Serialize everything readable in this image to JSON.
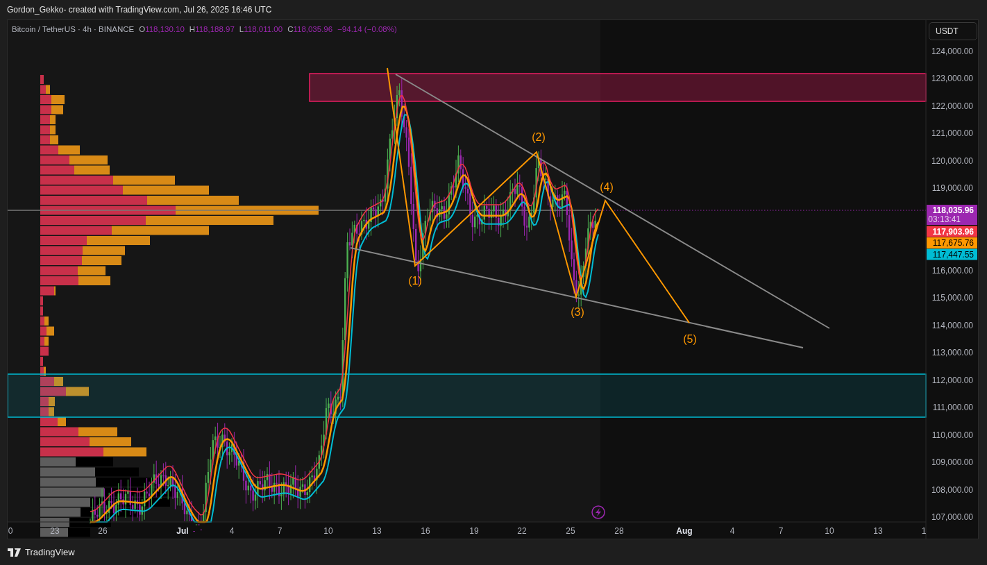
{
  "header": {
    "title": "Gordon_Gekko- created with TradingView.com, Jul 26, 2025 16:46 UTC"
  },
  "legend": {
    "symbol": "Bitcoin / TetherUS · 4h · BINANCE",
    "ohlc": [
      {
        "label": "O",
        "value": "118,130.10"
      },
      {
        "label": "H",
        "value": "118,188.97"
      },
      {
        "label": "L",
        "value": "118,011.00"
      },
      {
        "label": "C",
        "value": "118,035.96"
      }
    ],
    "change": "−94.14 (−0.08%)"
  },
  "currency_button": "USDT",
  "price_axis": {
    "ticks": [
      "124,000.00",
      "123,000.00",
      "122,000.00",
      "121,000.00",
      "120,000.00",
      "119,000.00",
      "116,000.00",
      "115,000.00",
      "114,000.00",
      "113,000.00",
      "112,000.00",
      "111,000.00",
      "110,000.00",
      "109,000.00",
      "108,000.00",
      "107,000.00"
    ]
  },
  "price_tags": [
    {
      "value": "118,035.96",
      "countdown": "03:13:41",
      "color": "#9c27b0"
    },
    {
      "value": "117,903.96",
      "color": "#f23645"
    },
    {
      "value": "117,675.76",
      "color": "#ff9800"
    },
    {
      "value": "117,447.55",
      "color": "#00bcd4"
    }
  ],
  "wave_labels": [
    "(1)",
    "(2)",
    "(3)",
    "(4)",
    "(5)"
  ],
  "time_axis": [
    {
      "label": "0",
      "kind": "day"
    },
    {
      "label": "23",
      "kind": "day"
    },
    {
      "label": "26",
      "kind": "day"
    },
    {
      "label": "Jul",
      "kind": "month"
    },
    {
      "label": "4",
      "kind": "day"
    },
    {
      "label": "7",
      "kind": "day"
    },
    {
      "label": "10",
      "kind": "day"
    },
    {
      "label": "13",
      "kind": "day"
    },
    {
      "label": "16",
      "kind": "day"
    },
    {
      "label": "19",
      "kind": "day"
    },
    {
      "label": "22",
      "kind": "day"
    },
    {
      "label": "25",
      "kind": "day"
    },
    {
      "label": "28",
      "kind": "day"
    },
    {
      "label": "Aug",
      "kind": "month"
    },
    {
      "label": "4",
      "kind": "day"
    },
    {
      "label": "7",
      "kind": "day"
    },
    {
      "label": "10",
      "kind": "day"
    },
    {
      "label": "13",
      "kind": "day"
    },
    {
      "label": "1",
      "kind": "day"
    }
  ],
  "footer": {
    "brand": "TradingView"
  }
}
